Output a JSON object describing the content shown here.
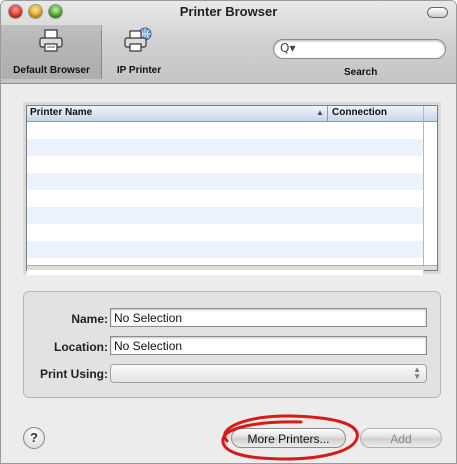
{
  "window": {
    "title": "Printer Browser"
  },
  "toolbar": {
    "items": [
      {
        "label": "Default Browser",
        "icon": "printer-icon",
        "selected": true
      },
      {
        "label": "IP Printer",
        "icon": "network-printer-icon",
        "selected": false
      }
    ],
    "search": {
      "label": "Search",
      "glyph": "Q▾",
      "value": ""
    }
  },
  "printer_list": {
    "columns": [
      "Printer Name",
      "Connection"
    ],
    "sort_indicator": "▲",
    "rows": []
  },
  "details": {
    "name_label": "Name:",
    "name_value": "No Selection",
    "location_label": "Location:",
    "location_value": "No Selection",
    "print_using_label": "Print Using:",
    "print_using_value": ""
  },
  "buttons": {
    "help": "?",
    "more_printers": "More Printers...",
    "add": "Add"
  },
  "colors": {
    "annotation_circle": "#d81a1a",
    "row_stripe": "#edf3fe"
  }
}
